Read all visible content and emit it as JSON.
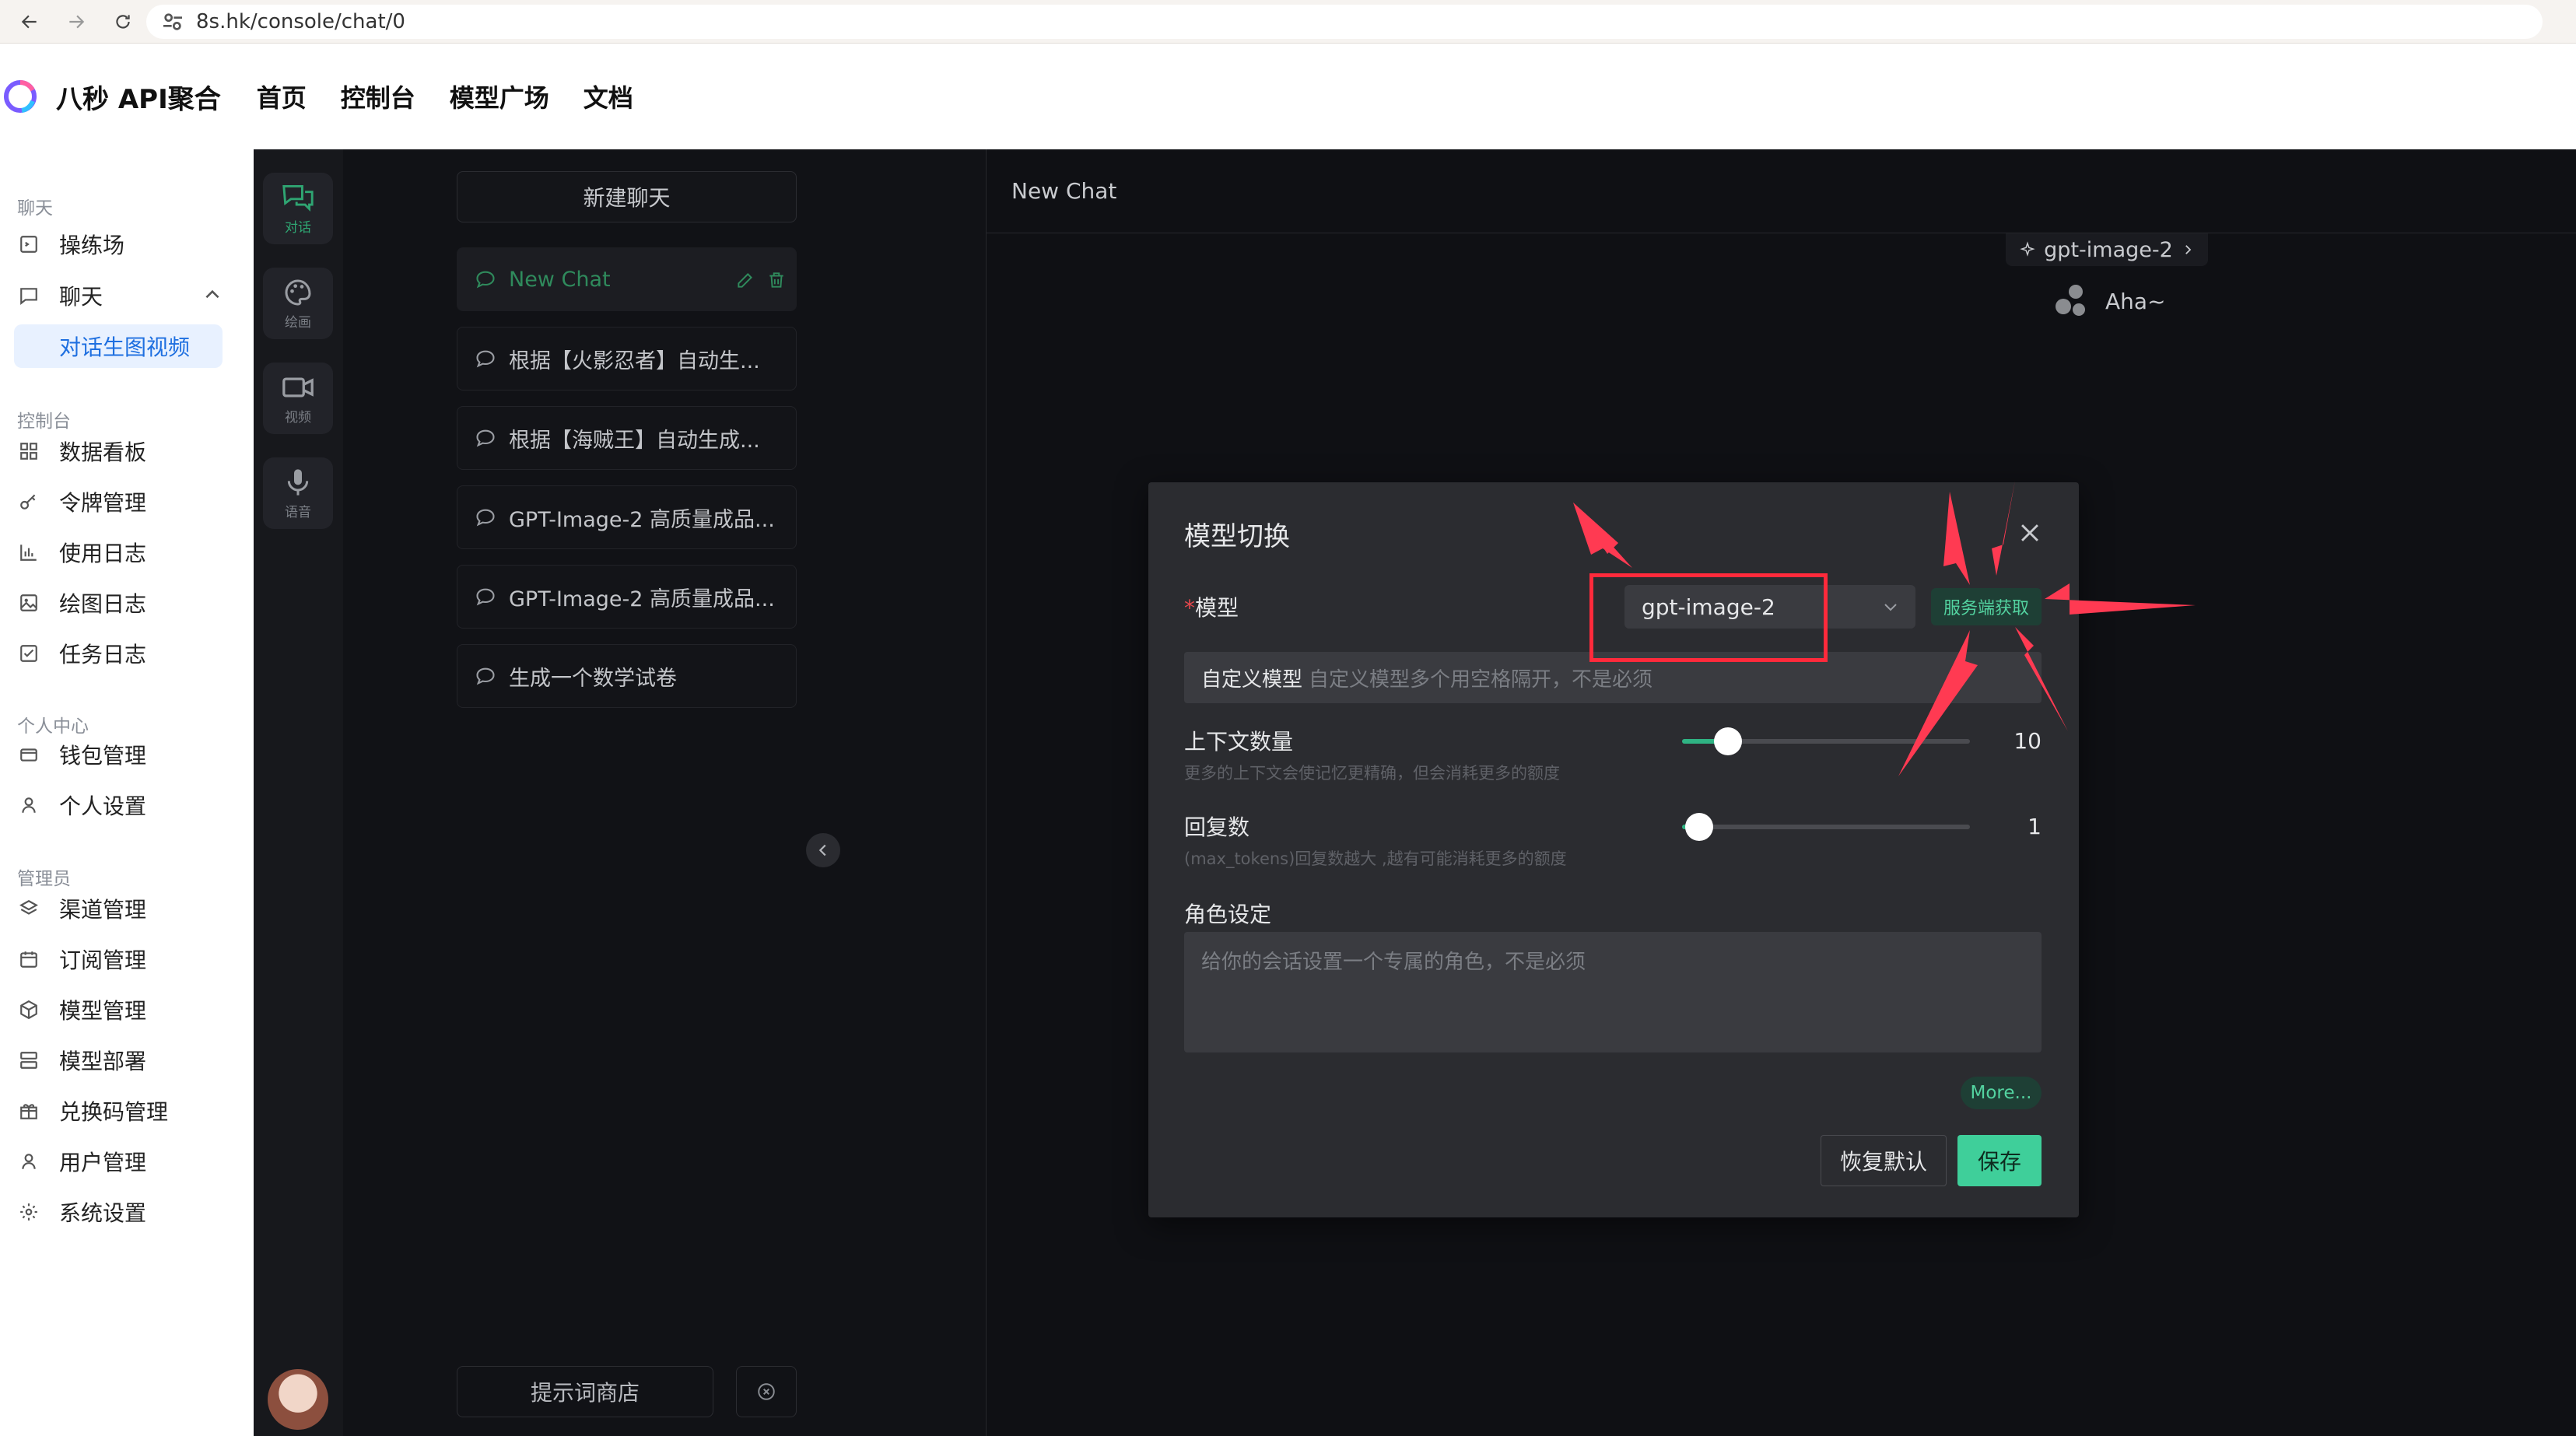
{
  "browser": {
    "url": "8s.hk/console/chat/0"
  },
  "header": {
    "brand": "八秒 API聚合",
    "nav": [
      "首页",
      "控制台",
      "模型广场",
      "文档"
    ]
  },
  "sidebar": {
    "sections": [
      {
        "title": "聊天",
        "items": [
          {
            "label": "操练场",
            "icon": "playground-icon"
          },
          {
            "label": "聊天",
            "icon": "chat-icon",
            "expanded": true
          },
          {
            "label": "对话生图视频",
            "active": true
          }
        ]
      },
      {
        "title": "控制台",
        "items": [
          {
            "label": "数据看板",
            "icon": "dashboard-icon"
          },
          {
            "label": "令牌管理",
            "icon": "key-icon"
          },
          {
            "label": "使用日志",
            "icon": "chart-icon"
          },
          {
            "label": "绘图日志",
            "icon": "image-icon"
          },
          {
            "label": "任务日志",
            "icon": "task-icon"
          }
        ]
      },
      {
        "title": "个人中心",
        "items": [
          {
            "label": "钱包管理",
            "icon": "wallet-icon"
          },
          {
            "label": "个人设置",
            "icon": "user-icon"
          }
        ]
      },
      {
        "title": "管理员",
        "items": [
          {
            "label": "渠道管理",
            "icon": "layers-icon"
          },
          {
            "label": "订阅管理",
            "icon": "calendar-icon"
          },
          {
            "label": "模型管理",
            "icon": "cube-icon"
          },
          {
            "label": "模型部署",
            "icon": "server-icon"
          },
          {
            "label": "兑换码管理",
            "icon": "gift-icon"
          },
          {
            "label": "用户管理",
            "icon": "user-icon"
          },
          {
            "label": "系统设置",
            "icon": "gear-icon"
          }
        ]
      }
    ]
  },
  "rail": [
    {
      "label": "对话",
      "icon": "chat-bubbles-icon",
      "active": true
    },
    {
      "label": "绘画",
      "icon": "palette-icon"
    },
    {
      "label": "视频",
      "icon": "video-icon"
    },
    {
      "label": "语音",
      "icon": "mic-icon"
    }
  ],
  "chat_list": {
    "new_chat": "新建聊天",
    "items": [
      "New Chat",
      "根据【火影忍者】自动生...",
      "根据【海贼王】自动生成...",
      "GPT-Image-2 高质量成品...",
      "GPT-Image-2 高质量成品...",
      "生成一个数学试卷"
    ],
    "prompt_store": "提示词商店"
  },
  "chat_main": {
    "title": "New Chat",
    "model_chip": "gpt-image-2",
    "greeting": "Aha~"
  },
  "modal": {
    "title": "模型切换",
    "model_label": "模型",
    "model_value": "gpt-image-2",
    "fetch_btn": "服务端获取",
    "custom_label": "自定义模型",
    "custom_placeholder": "自定义模型多个用空格隔开，不是必须",
    "context_label": "上下文数量",
    "context_hint": "更多的上下文会使记忆更精确，但会消耗更多的额度",
    "context_value": "10",
    "context_fraction": 0.1,
    "reply_label": "回复数",
    "reply_hint": "(max_tokens)回复数越大 ,越有可能消耗更多的额度",
    "reply_value": "1",
    "reply_fraction": 0.0,
    "role_label": "角色设定",
    "role_placeholder": "给你的会话设置一个专属的角色，不是必须",
    "more": "More...",
    "reset": "恢复默认",
    "save": "保存"
  },
  "colors": {
    "accent": "#3fcf9a",
    "annotation": "#ff2a3b"
  }
}
